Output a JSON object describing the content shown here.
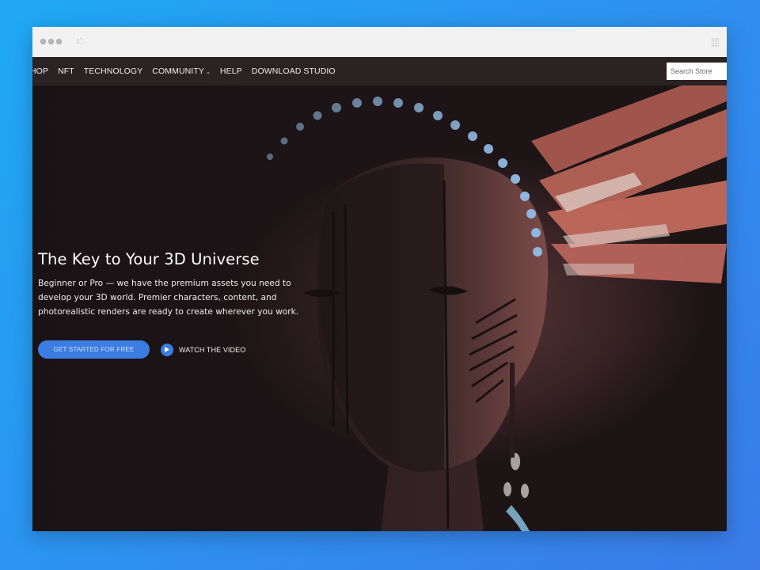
{
  "navbar": {
    "items": [
      {
        "label": "HOP"
      },
      {
        "label": "NFT"
      },
      {
        "label": "TECHNOLOGY"
      },
      {
        "label": "COMMUNITY"
      },
      {
        "label": "HELP"
      },
      {
        "label": "DOWNLOAD STUDIO"
      }
    ],
    "search_placeholder": "Search Store"
  },
  "hero": {
    "title": "The Key to Your 3D Universe",
    "description": "Beginner or Pro — we have the premium assets you need to develop your 3D world. Premier characters, content, and photorealistic renders are ready to create wherever you work.",
    "cta_label": "GET STARTED FOR FREE",
    "video_label": "WATCH THE VIDEO"
  },
  "colors": {
    "accent": "#3b7de0",
    "navbar": "#2a2223",
    "background_gradient_start": "#1fa9f5",
    "background_gradient_end": "#3a7be8"
  }
}
